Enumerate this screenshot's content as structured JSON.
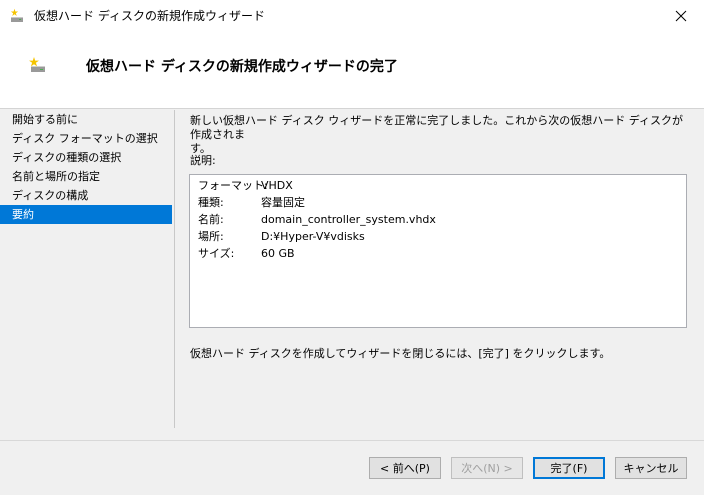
{
  "window": {
    "title": "仮想ハード ディスクの新規作成ウィザード",
    "icon": "virtual-disk-icon"
  },
  "header": {
    "title": "仮想ハード ディスクの新規作成ウィザードの完了"
  },
  "nav": {
    "items": [
      {
        "label": "開始する前に",
        "selected": false
      },
      {
        "label": "ディスク フォーマットの選択",
        "selected": false
      },
      {
        "label": "ディスクの種類の選択",
        "selected": false
      },
      {
        "label": "名前と場所の指定",
        "selected": false
      },
      {
        "label": "ディスクの構成",
        "selected": false
      },
      {
        "label": "要約",
        "selected": true
      }
    ]
  },
  "main": {
    "intro_line1": "新しい仮想ハード ディスク ウィザードを正常に完了しました。これから次の仮想ハード ディスクが作成されま",
    "intro_line2": "す。",
    "description_label": "説明:",
    "summary": [
      {
        "key": "フォーマット:",
        "value": "VHDX"
      },
      {
        "key": "種類:",
        "value": "容量固定"
      },
      {
        "key": "名前:",
        "value": "domain_controller_system.vhdx"
      },
      {
        "key": "場所:",
        "value": "D:¥Hyper-V¥vdisks"
      },
      {
        "key": "サイズ:",
        "value": "60 GB"
      }
    ],
    "footer_text": "仮想ハード ディスクを作成してウィザードを閉じるには、[完了] をクリックします。"
  },
  "buttons": {
    "back": "< 前へ(P)",
    "next": "次へ(N) >",
    "finish": "完了(F)",
    "cancel": "キャンセル"
  },
  "colors": {
    "accent": "#0078d7",
    "selected_text": "#ffffff"
  }
}
